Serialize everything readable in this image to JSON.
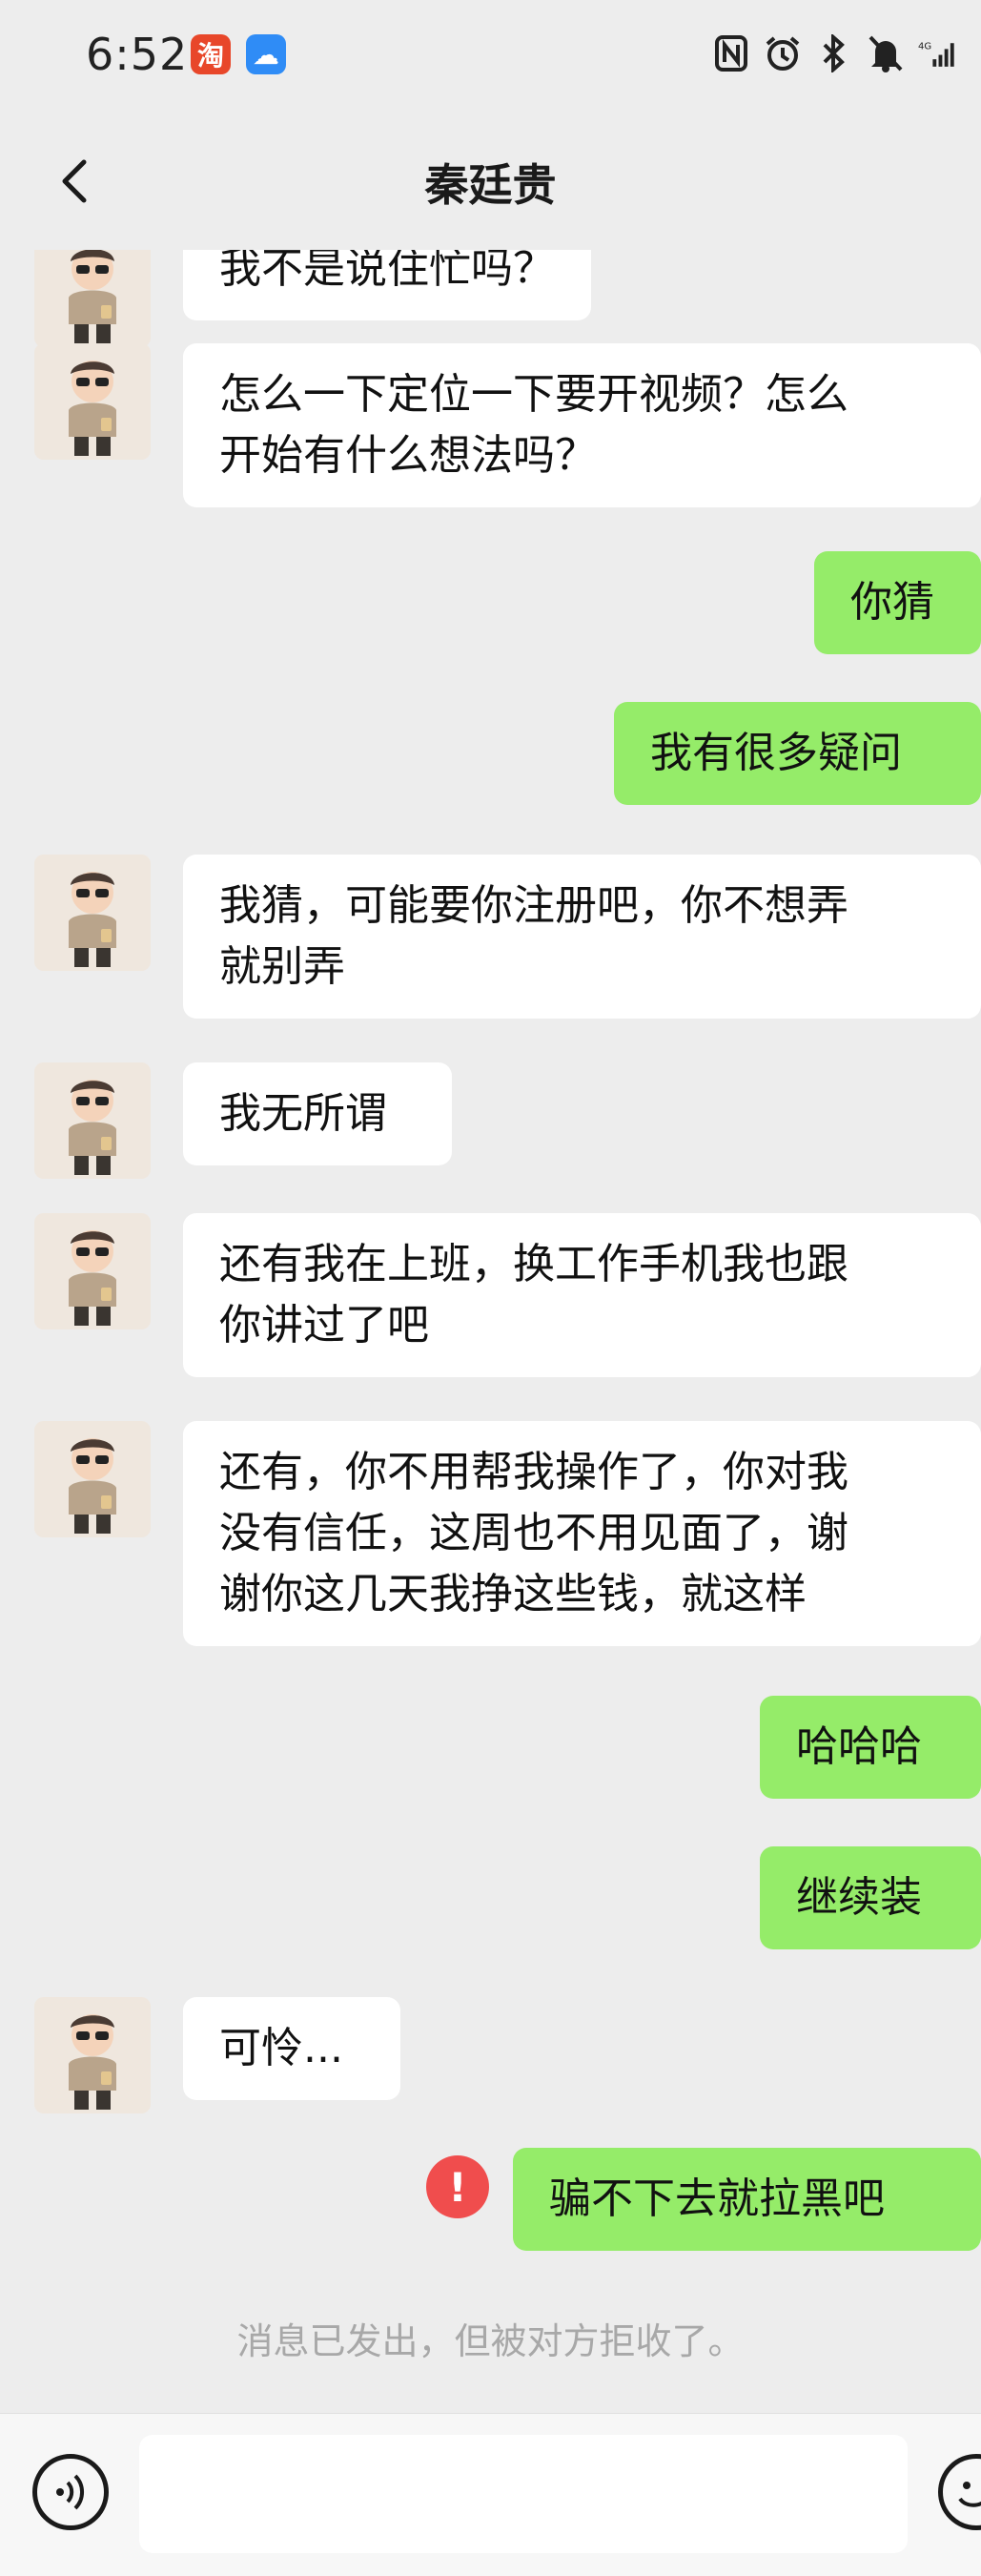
{
  "status_bar": {
    "time": "6:52",
    "apps": [
      {
        "name": "taobao-icon",
        "glyph": "淘"
      },
      {
        "name": "cloud-icon",
        "glyph": "☁"
      }
    ],
    "icons": [
      "nfc-icon",
      "alarm-icon",
      "bluetooth-icon",
      "mute-icon",
      "signal-4g-icon"
    ]
  },
  "header": {
    "title": "秦廷贵",
    "back_icon": "chevron-left-icon"
  },
  "messages": [
    {
      "dir": "in",
      "lines": [
        "我不是说住忙吗？"
      ]
    },
    {
      "dir": "in",
      "lines": [
        "怎么一下定位一下要开视频？怎么",
        "开始有什么想法吗？"
      ]
    },
    {
      "dir": "out",
      "lines": [
        "你猜"
      ]
    },
    {
      "dir": "out",
      "lines": [
        "我有很多疑问"
      ]
    },
    {
      "dir": "in",
      "lines": [
        "我猜，可能要你注册吧，你不想弄",
        "就别弄"
      ]
    },
    {
      "dir": "in",
      "lines": [
        "我无所谓"
      ]
    },
    {
      "dir": "in",
      "lines": [
        "还有我在上班，换工作手机我也跟",
        "你讲过了吧"
      ]
    },
    {
      "dir": "in",
      "lines": [
        "还有，你不用帮我操作了，你对我",
        "没有信任，这周也不用见面了，谢",
        "谢你这几天我挣这些钱，就这样"
      ]
    },
    {
      "dir": "out",
      "lines": [
        "哈哈哈"
      ]
    },
    {
      "dir": "out",
      "lines": [
        "继续装"
      ]
    },
    {
      "dir": "in",
      "lines": [
        "可怜..."
      ]
    },
    {
      "dir": "out",
      "lines": [
        "骗不下去就拉黑吧"
      ],
      "failed": true
    }
  ],
  "failure_icon": "!",
  "system_notice": "消息已发出，但被对方拒收了。",
  "input_bar": {
    "voice_icon": "voice-icon",
    "emoji_icon": "emoji-icon",
    "placeholder": ""
  },
  "colors": {
    "background": "#ededed",
    "outgoing_bubble": "#95ec69",
    "incoming_bubble": "#ffffff",
    "error": "#f04d4d"
  }
}
